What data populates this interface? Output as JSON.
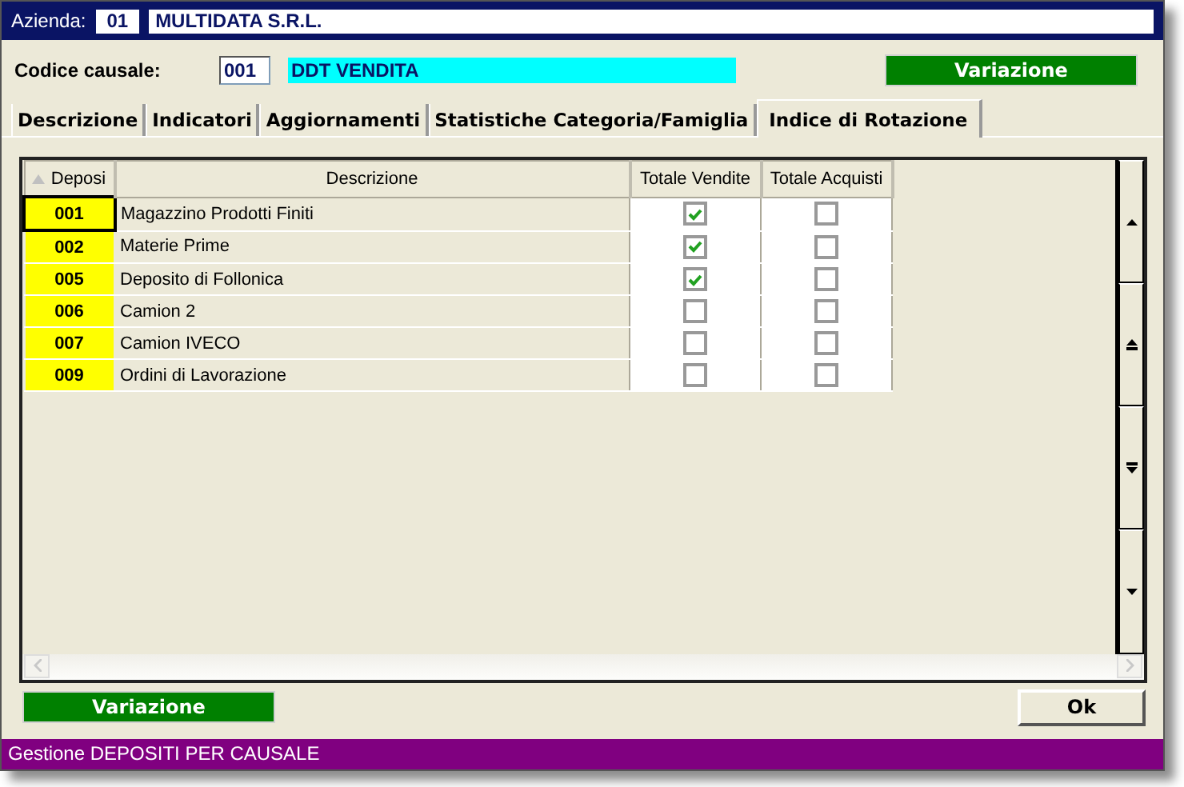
{
  "window": {
    "company_label": "Azienda:",
    "company_code": "01",
    "company_name": "MULTIDATA S.R.L."
  },
  "header": {
    "label": "Codice causale:",
    "code": "001",
    "description": "DDT VENDITA",
    "mode_button": "Variazione"
  },
  "tabs": [
    {
      "label": "Descrizione",
      "selected": false
    },
    {
      "label": "Indicatori",
      "selected": false
    },
    {
      "label": "Aggiornamenti",
      "selected": false
    },
    {
      "label": "Statistiche Categoria/Famiglia",
      "selected": false
    },
    {
      "label": "Indice di Rotazione",
      "selected": true
    }
  ],
  "table": {
    "columns": [
      "Deposi",
      "Descrizione",
      "Totale Vendite",
      "Totale Acquisti"
    ],
    "rows": [
      {
        "code": "001",
        "description": "Magazzino Prodotti Finiti",
        "totale_vendite": true,
        "totale_acquisti": false,
        "selected": true
      },
      {
        "code": "002",
        "description": "Materie Prime",
        "totale_vendite": true,
        "totale_acquisti": false,
        "selected": false
      },
      {
        "code": "005",
        "description": "Deposito di Follonica",
        "totale_vendite": true,
        "totale_acquisti": false,
        "selected": false
      },
      {
        "code": "006",
        "description": "Camion 2",
        "totale_vendite": false,
        "totale_acquisti": false,
        "selected": false
      },
      {
        "code": "007",
        "description": "Camion IVECO",
        "totale_vendite": false,
        "totale_acquisti": false,
        "selected": false
      },
      {
        "code": "009",
        "description": "Ordini di Lavorazione",
        "totale_vendite": false,
        "totale_acquisti": false,
        "selected": false
      }
    ]
  },
  "buttons": [
    {
      "label": "Variazione",
      "kind": "mode"
    },
    {
      "label": "Ok",
      "kind": "plain"
    }
  ],
  "status_bar": "Gestione DEPOSITI PER CAUSALE"
}
